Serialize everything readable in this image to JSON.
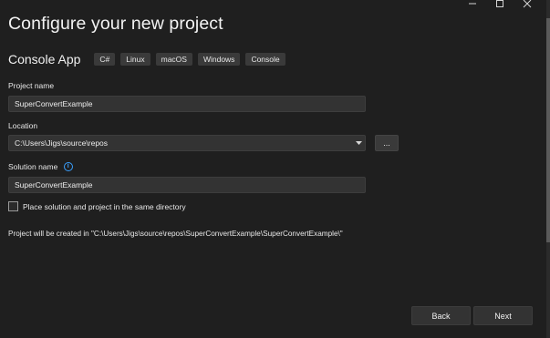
{
  "window": {
    "minimize_icon": "minimize-icon",
    "maximize_icon": "maximize-icon",
    "close_icon": "close-icon"
  },
  "header": {
    "title": "Configure your new project"
  },
  "template": {
    "name": "Console App",
    "tags": [
      "C#",
      "Linux",
      "macOS",
      "Windows",
      "Console"
    ]
  },
  "form": {
    "project_name_label": "Project name",
    "project_name_value": "SuperConvertExample",
    "location_label": "Location",
    "location_value": "C:\\Users\\Jigs\\source\\repos",
    "browse_label": "...",
    "solution_name_label": "Solution name",
    "solution_name_value": "SuperConvertExample",
    "same_directory_label": "Place solution and project in the same directory",
    "same_directory_checked": false,
    "path_message": "Project will be created in \"C:\\Users\\Jigs\\source\\repos\\SuperConvertExample\\SuperConvertExample\\\""
  },
  "footer": {
    "back_label": "Back",
    "next_label": "Next"
  },
  "colors": {
    "background": "#1f1f1f",
    "field": "#333333",
    "tag": "#3a3a3a",
    "info_accent": "#3aa0ff"
  }
}
